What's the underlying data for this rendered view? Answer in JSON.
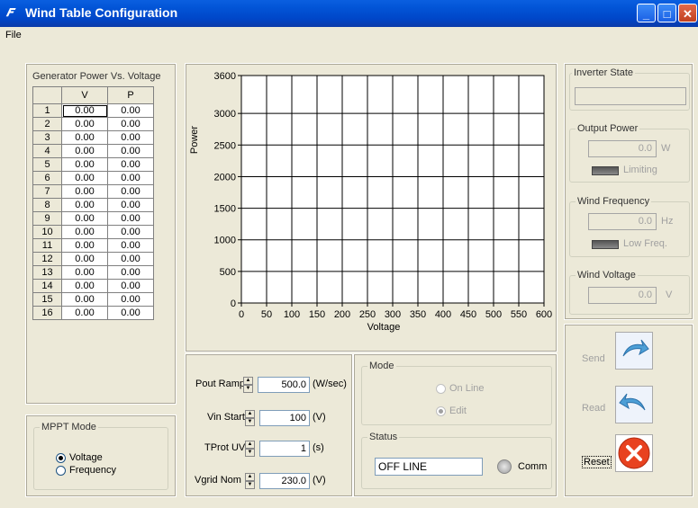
{
  "window": {
    "title": "Wind Table Configuration"
  },
  "menu": {
    "file": "File"
  },
  "generator_table": {
    "title": "Generator Power Vs. Voltage",
    "headers": [
      "V",
      "P"
    ],
    "rows": [
      {
        "n": "1",
        "v": "0.00",
        "p": "0.00"
      },
      {
        "n": "2",
        "v": "0.00",
        "p": "0.00"
      },
      {
        "n": "3",
        "v": "0.00",
        "p": "0.00"
      },
      {
        "n": "4",
        "v": "0.00",
        "p": "0.00"
      },
      {
        "n": "5",
        "v": "0.00",
        "p": "0.00"
      },
      {
        "n": "6",
        "v": "0.00",
        "p": "0.00"
      },
      {
        "n": "7",
        "v": "0.00",
        "p": "0.00"
      },
      {
        "n": "8",
        "v": "0.00",
        "p": "0.00"
      },
      {
        "n": "9",
        "v": "0.00",
        "p": "0.00"
      },
      {
        "n": "10",
        "v": "0.00",
        "p": "0.00"
      },
      {
        "n": "11",
        "v": "0.00",
        "p": "0.00"
      },
      {
        "n": "12",
        "v": "0.00",
        "p": "0.00"
      },
      {
        "n": "13",
        "v": "0.00",
        "p": "0.00"
      },
      {
        "n": "14",
        "v": "0.00",
        "p": "0.00"
      },
      {
        "n": "15",
        "v": "0.00",
        "p": "0.00"
      },
      {
        "n": "16",
        "v": "0.00",
        "p": "0.00"
      }
    ]
  },
  "chart_data": {
    "type": "line",
    "xlabel": "Voltage",
    "ylabel": "Power",
    "xlim": [
      0,
      600
    ],
    "ylim": [
      0,
      3600
    ],
    "xticks": [
      "0",
      "50",
      "100",
      "150",
      "200",
      "250",
      "300",
      "350",
      "400",
      "450",
      "500",
      "550",
      "600"
    ],
    "yticks": [
      "0",
      "500",
      "1000",
      "1500",
      "2000",
      "2500",
      "3000",
      "3600"
    ],
    "grid": true,
    "series": []
  },
  "mppt": {
    "title": "MPPT Mode",
    "options": [
      "Voltage",
      "Frequency"
    ],
    "selected": "Voltage"
  },
  "params": {
    "pout_ramp": {
      "label": "Pout Ramp",
      "value": "500.0",
      "unit": "(W/sec)"
    },
    "vin_start": {
      "label": "Vin Start",
      "value": "100",
      "unit": "(V)"
    },
    "tprot_uv": {
      "label": "TProt UV",
      "value": "1",
      "unit": "(s)"
    },
    "vgrid_nom": {
      "label": "Vgrid Nom",
      "value": "230.0",
      "unit": "(V)"
    }
  },
  "mode": {
    "title": "Mode",
    "options": [
      "On Line",
      "Edit"
    ],
    "selected": "Edit"
  },
  "status": {
    "title": "Status",
    "value": "OFF LINE",
    "comm_label": "Comm"
  },
  "inverter_state": {
    "title": "Inverter State",
    "value": ""
  },
  "output_power": {
    "title": "Output Power",
    "value": "0.0",
    "unit": "W",
    "led_label": "Limiting"
  },
  "wind_frequency": {
    "title": "Wind Frequency",
    "value": "0.0",
    "unit": "Hz",
    "led_label": "Low Freq."
  },
  "wind_voltage": {
    "title": "Wind Voltage",
    "value": "0.0",
    "unit": "V"
  },
  "actions": {
    "send": "Send",
    "read": "Read",
    "reset": "Reset"
  }
}
